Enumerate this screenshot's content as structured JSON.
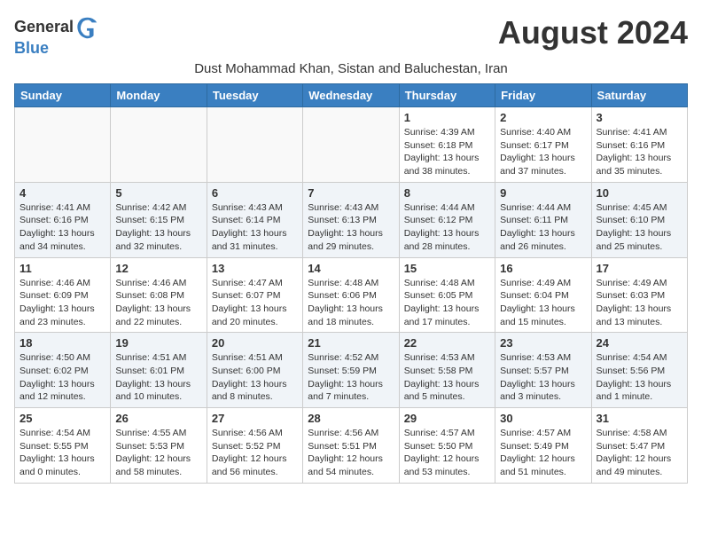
{
  "header": {
    "logo_general": "General",
    "logo_blue": "Blue",
    "month_year": "August 2024",
    "location": "Dust Mohammad Khan, Sistan and Baluchestan, Iran"
  },
  "weekdays": [
    "Sunday",
    "Monday",
    "Tuesday",
    "Wednesday",
    "Thursday",
    "Friday",
    "Saturday"
  ],
  "weeks": [
    [
      {
        "day": "",
        "info": ""
      },
      {
        "day": "",
        "info": ""
      },
      {
        "day": "",
        "info": ""
      },
      {
        "day": "",
        "info": ""
      },
      {
        "day": "1",
        "info": "Sunrise: 4:39 AM\nSunset: 6:18 PM\nDaylight: 13 hours\nand 38 minutes."
      },
      {
        "day": "2",
        "info": "Sunrise: 4:40 AM\nSunset: 6:17 PM\nDaylight: 13 hours\nand 37 minutes."
      },
      {
        "day": "3",
        "info": "Sunrise: 4:41 AM\nSunset: 6:16 PM\nDaylight: 13 hours\nand 35 minutes."
      }
    ],
    [
      {
        "day": "4",
        "info": "Sunrise: 4:41 AM\nSunset: 6:16 PM\nDaylight: 13 hours\nand 34 minutes."
      },
      {
        "day": "5",
        "info": "Sunrise: 4:42 AM\nSunset: 6:15 PM\nDaylight: 13 hours\nand 32 minutes."
      },
      {
        "day": "6",
        "info": "Sunrise: 4:43 AM\nSunset: 6:14 PM\nDaylight: 13 hours\nand 31 minutes."
      },
      {
        "day": "7",
        "info": "Sunrise: 4:43 AM\nSunset: 6:13 PM\nDaylight: 13 hours\nand 29 minutes."
      },
      {
        "day": "8",
        "info": "Sunrise: 4:44 AM\nSunset: 6:12 PM\nDaylight: 13 hours\nand 28 minutes."
      },
      {
        "day": "9",
        "info": "Sunrise: 4:44 AM\nSunset: 6:11 PM\nDaylight: 13 hours\nand 26 minutes."
      },
      {
        "day": "10",
        "info": "Sunrise: 4:45 AM\nSunset: 6:10 PM\nDaylight: 13 hours\nand 25 minutes."
      }
    ],
    [
      {
        "day": "11",
        "info": "Sunrise: 4:46 AM\nSunset: 6:09 PM\nDaylight: 13 hours\nand 23 minutes."
      },
      {
        "day": "12",
        "info": "Sunrise: 4:46 AM\nSunset: 6:08 PM\nDaylight: 13 hours\nand 22 minutes."
      },
      {
        "day": "13",
        "info": "Sunrise: 4:47 AM\nSunset: 6:07 PM\nDaylight: 13 hours\nand 20 minutes."
      },
      {
        "day": "14",
        "info": "Sunrise: 4:48 AM\nSunset: 6:06 PM\nDaylight: 13 hours\nand 18 minutes."
      },
      {
        "day": "15",
        "info": "Sunrise: 4:48 AM\nSunset: 6:05 PM\nDaylight: 13 hours\nand 17 minutes."
      },
      {
        "day": "16",
        "info": "Sunrise: 4:49 AM\nSunset: 6:04 PM\nDaylight: 13 hours\nand 15 minutes."
      },
      {
        "day": "17",
        "info": "Sunrise: 4:49 AM\nSunset: 6:03 PM\nDaylight: 13 hours\nand 13 minutes."
      }
    ],
    [
      {
        "day": "18",
        "info": "Sunrise: 4:50 AM\nSunset: 6:02 PM\nDaylight: 13 hours\nand 12 minutes."
      },
      {
        "day": "19",
        "info": "Sunrise: 4:51 AM\nSunset: 6:01 PM\nDaylight: 13 hours\nand 10 minutes."
      },
      {
        "day": "20",
        "info": "Sunrise: 4:51 AM\nSunset: 6:00 PM\nDaylight: 13 hours\nand 8 minutes."
      },
      {
        "day": "21",
        "info": "Sunrise: 4:52 AM\nSunset: 5:59 PM\nDaylight: 13 hours\nand 7 minutes."
      },
      {
        "day": "22",
        "info": "Sunrise: 4:53 AM\nSunset: 5:58 PM\nDaylight: 13 hours\nand 5 minutes."
      },
      {
        "day": "23",
        "info": "Sunrise: 4:53 AM\nSunset: 5:57 PM\nDaylight: 13 hours\nand 3 minutes."
      },
      {
        "day": "24",
        "info": "Sunrise: 4:54 AM\nSunset: 5:56 PM\nDaylight: 13 hours\nand 1 minute."
      }
    ],
    [
      {
        "day": "25",
        "info": "Sunrise: 4:54 AM\nSunset: 5:55 PM\nDaylight: 13 hours\nand 0 minutes."
      },
      {
        "day": "26",
        "info": "Sunrise: 4:55 AM\nSunset: 5:53 PM\nDaylight: 12 hours\nand 58 minutes."
      },
      {
        "day": "27",
        "info": "Sunrise: 4:56 AM\nSunset: 5:52 PM\nDaylight: 12 hours\nand 56 minutes."
      },
      {
        "day": "28",
        "info": "Sunrise: 4:56 AM\nSunset: 5:51 PM\nDaylight: 12 hours\nand 54 minutes."
      },
      {
        "day": "29",
        "info": "Sunrise: 4:57 AM\nSunset: 5:50 PM\nDaylight: 12 hours\nand 53 minutes."
      },
      {
        "day": "30",
        "info": "Sunrise: 4:57 AM\nSunset: 5:49 PM\nDaylight: 12 hours\nand 51 minutes."
      },
      {
        "day": "31",
        "info": "Sunrise: 4:58 AM\nSunset: 5:47 PM\nDaylight: 12 hours\nand 49 minutes."
      }
    ]
  ]
}
